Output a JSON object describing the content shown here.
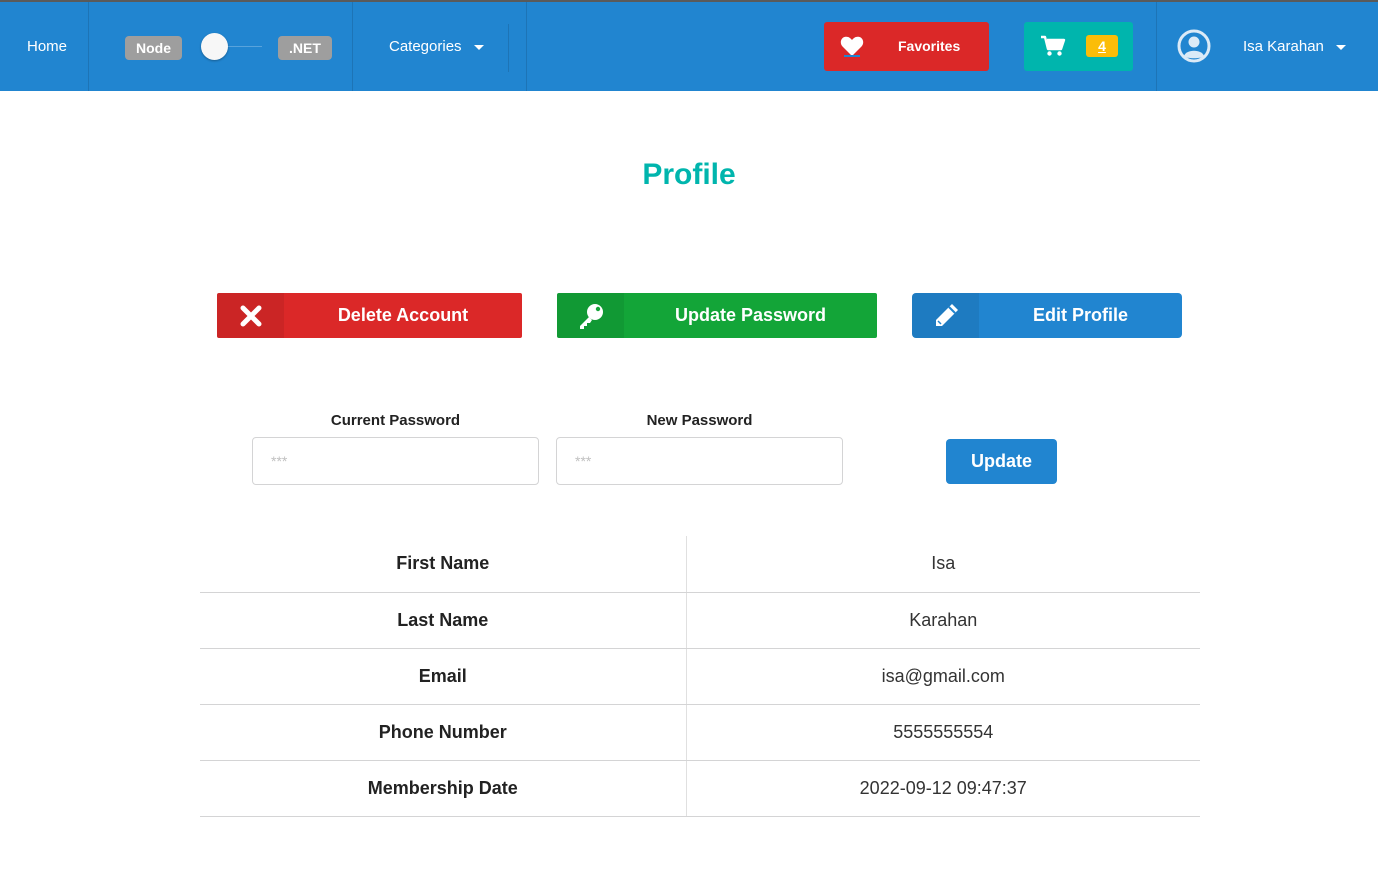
{
  "navbar": {
    "home_label": "Home",
    "toggle": {
      "left_label": "Node",
      "right_label": ".NET"
    },
    "categories_label": "Categories",
    "favorites_label": "Favorites",
    "cart_count": "4",
    "user_name": "Isa Karahan"
  },
  "page": {
    "title": "Profile"
  },
  "actions": {
    "delete_label": "Delete Account",
    "update_password_label": "Update Password",
    "edit_profile_label": "Edit Profile"
  },
  "password_form": {
    "current_label": "Current Password",
    "current_placeholder": "***",
    "new_label": "New Password",
    "new_placeholder": "***",
    "submit_label": "Update"
  },
  "profile_table": {
    "rows": [
      {
        "key": "First Name",
        "value": "Isa"
      },
      {
        "key": "Last Name",
        "value": "Karahan"
      },
      {
        "key": "Email",
        "value": "isa@gmail.com"
      },
      {
        "key": "Phone Number",
        "value": "5555555554"
      },
      {
        "key": "Membership Date",
        "value": "2022-09-12 09:47:37"
      }
    ]
  },
  "colors": {
    "navbar": "#2185d0",
    "title": "#00b5ad",
    "danger": "#db2828",
    "success": "#13a538",
    "primary": "#2185d0",
    "badge": "#fbbd08",
    "teal": "#00b5ad"
  },
  "icons": {
    "favorites": "heart-icon",
    "cart": "cart-icon",
    "user": "user-circle-icon",
    "delete": "times-icon",
    "password": "key-icon",
    "edit": "pencil-icon"
  }
}
